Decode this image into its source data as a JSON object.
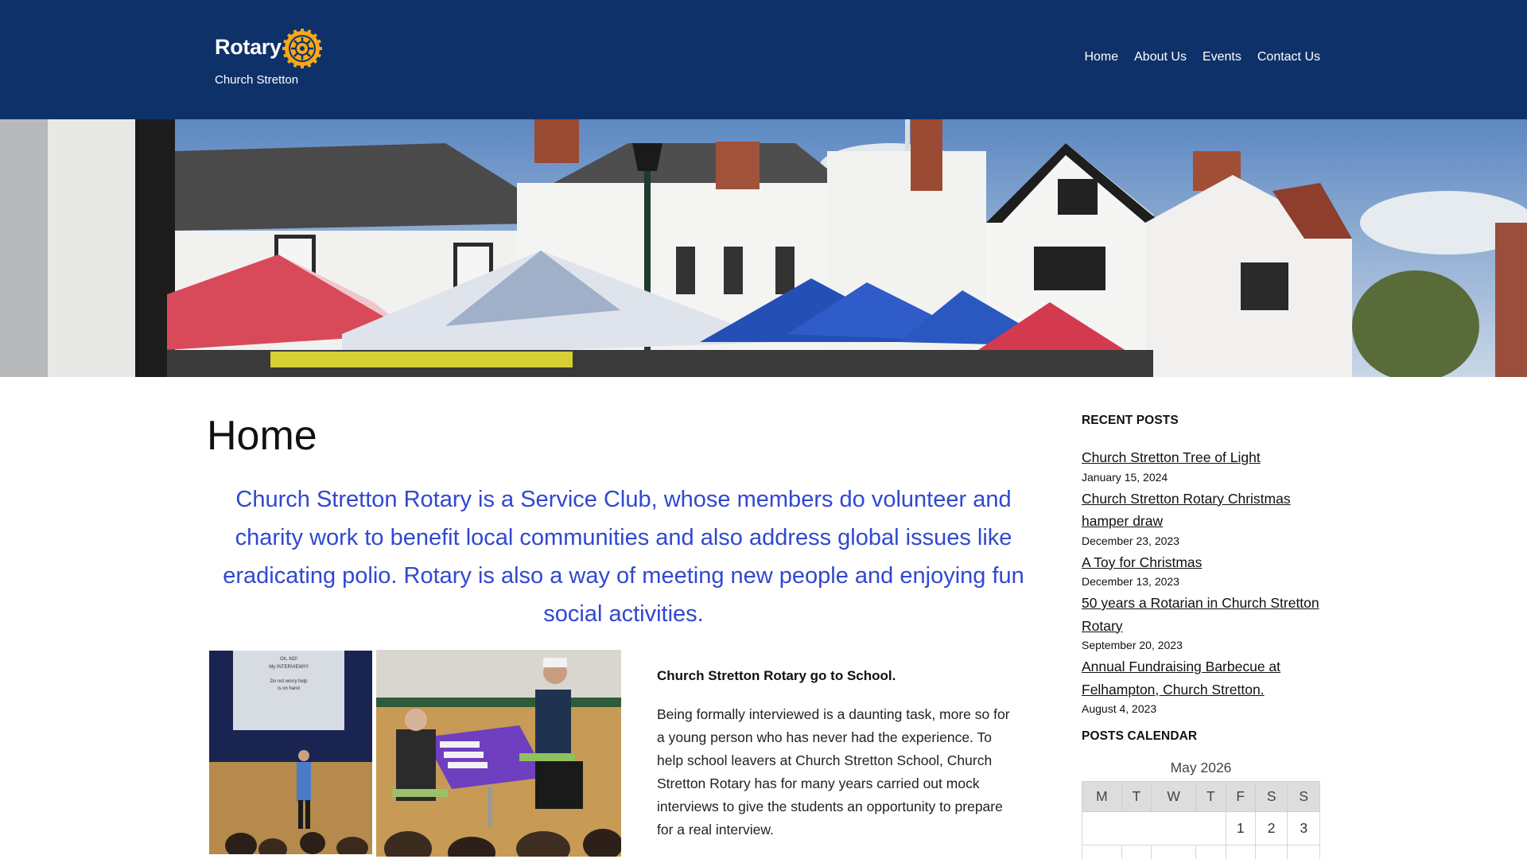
{
  "header": {
    "brand_word": "Rotary",
    "brand_sub": "Church Stretton",
    "nav": [
      {
        "label": "Home"
      },
      {
        "label": "About Us"
      },
      {
        "label": "Events"
      },
      {
        "label": "Contact Us"
      }
    ]
  },
  "main": {
    "page_title": "Home",
    "intro": "Church Stretton Rotary is a Service Club, whose members do volunteer and charity work to benefit local communities and also address global issues like eradicating polio. Rotary is also a way of meeting new people and enjoying fun social activities.",
    "post_heading": "Church Stretton Rotary go to School.",
    "post_body": "Being formally interviewed is a daunting task, more so for a young person who has never had the experience. To help school leavers at Church Stretton School, Church Stretton Rotary has for many years carried out mock interviews to give the students an opportunity to prepare for a real interview.",
    "slide_text": [
      "Oh, NO!",
      "My INTERVIEW!!!!",
      "Do not worry help",
      "is on hand"
    ]
  },
  "sidebar": {
    "recent_title": "RECENT POSTS",
    "recent_posts": [
      {
        "title": "Church Stretton Tree of Light",
        "date": "January 15, 2024"
      },
      {
        "title": "Church Stretton Rotary Christmas hamper draw",
        "date": "December 23, 2023"
      },
      {
        "title": "A Toy for Christmas",
        "date": "December 13, 2023"
      },
      {
        "title": "50 years a Rotarian in Church Stretton Rotary",
        "date": "September 20, 2023"
      },
      {
        "title": "Annual Fundraising Barbecue at Felhampton, Church Stretton.",
        "date": "August 4, 2023"
      }
    ],
    "calendar_title": "POSTS CALENDAR",
    "calendar": {
      "month": "May 2026",
      "weekdays": [
        "M",
        "T",
        "W",
        "T",
        "F",
        "S",
        "S"
      ],
      "first_row": [
        "",
        "",
        "",
        "",
        "1",
        "2",
        "3"
      ]
    }
  },
  "colors": {
    "header_bg": "#0f3169",
    "intro_text": "#3048d0",
    "rotary_gold": "#f7a81b"
  }
}
